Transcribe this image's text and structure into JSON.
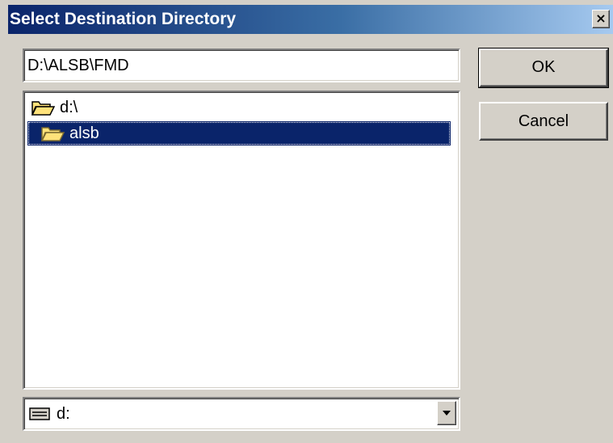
{
  "window": {
    "title": "Select Destination Directory",
    "close_glyph": "✕"
  },
  "path_field": {
    "value": "D:\\ALSB\\FMD"
  },
  "tree": {
    "items": [
      {
        "label": "d:\\",
        "icon": "open-folder-icon",
        "selected": false
      },
      {
        "label": "alsb",
        "icon": "open-folder-icon",
        "selected": true
      }
    ]
  },
  "drive_select": {
    "value": "d:",
    "icon": "drive-icon"
  },
  "buttons": {
    "ok_label": "OK",
    "cancel_label": "Cancel"
  },
  "colors": {
    "title_bar": "#0a246a",
    "selection": "#0a246a",
    "dialog_face": "#d4d0c8",
    "folder": "#ffe27a"
  }
}
